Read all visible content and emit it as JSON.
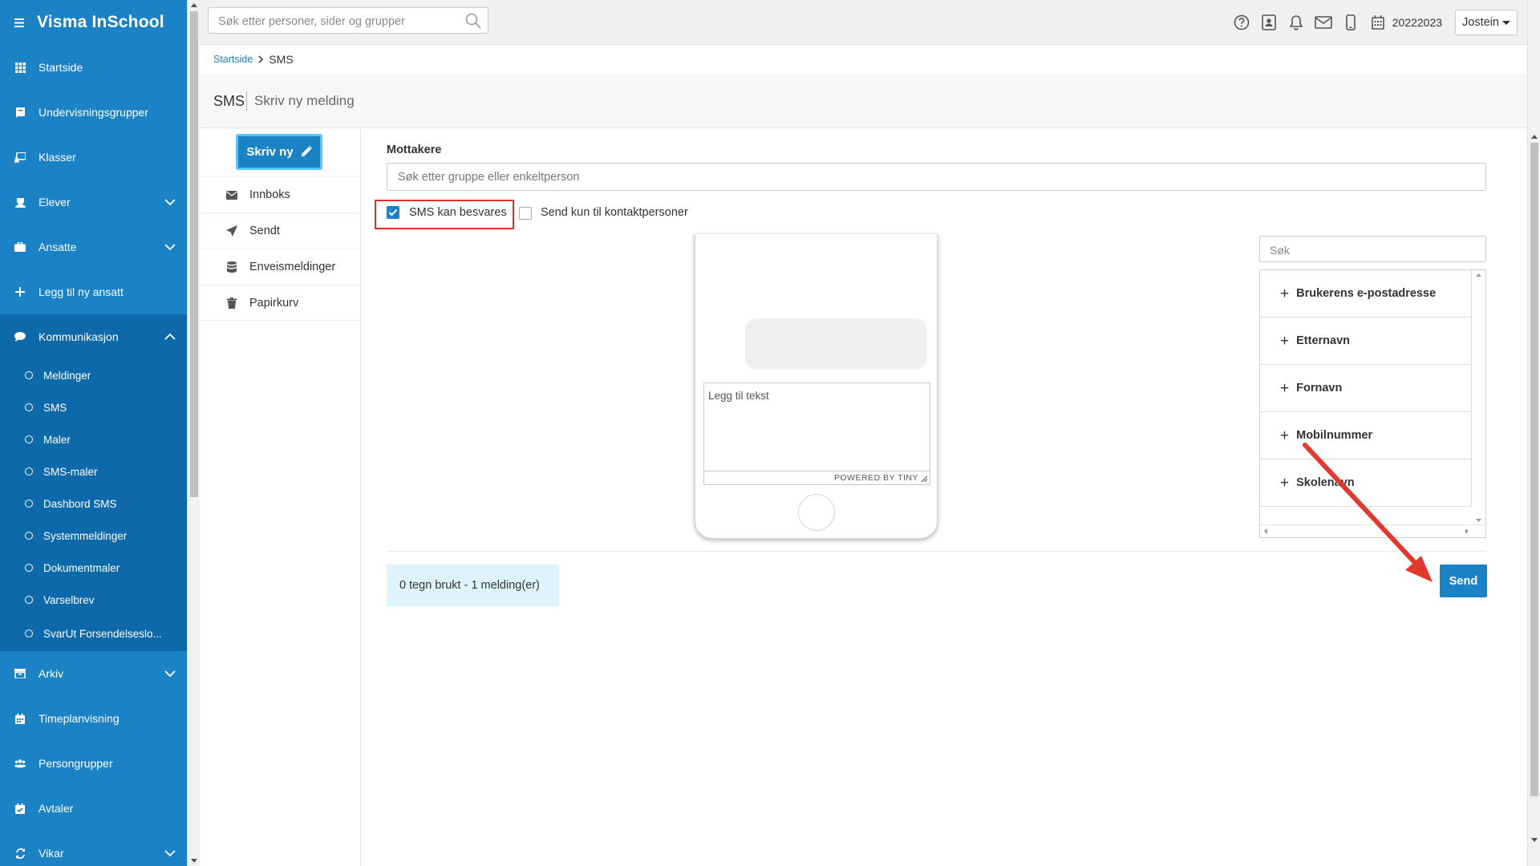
{
  "app": {
    "title": "Visma InSchool"
  },
  "sidebar": {
    "items": [
      {
        "label": "Startside",
        "icon": "grid-icon"
      },
      {
        "label": "Undervisningsgrupper",
        "icon": "book-icon"
      },
      {
        "label": "Klasser",
        "icon": "chalkboard-icon"
      },
      {
        "label": "Elever",
        "icon": "student-icon"
      },
      {
        "label": "Ansatte",
        "icon": "briefcase-icon"
      },
      {
        "label": "Legg til ny ansatt",
        "icon": "plus-icon"
      },
      {
        "label": "Kommunikasjon",
        "icon": "chat-icon"
      },
      {
        "label": "Arkiv",
        "icon": "archive-icon"
      },
      {
        "label": "Timeplanvisning",
        "icon": "calendar-icon"
      },
      {
        "label": "Persongrupper",
        "icon": "users-icon"
      },
      {
        "label": "Avtaler",
        "icon": "calendar-check-icon"
      },
      {
        "label": "Vikar",
        "icon": "swap-icon"
      }
    ],
    "sub_items": [
      "Meldinger",
      "SMS",
      "Maler",
      "SMS-maler",
      "Dashbord SMS",
      "Systemmeldinger",
      "Dokumentmaler",
      "Varselbrev",
      "SvarUt Forsendelseslo..."
    ]
  },
  "topbar": {
    "search_placeholder": "Søk etter personer, sider og grupper",
    "year": "20222023",
    "user": "Jostein"
  },
  "breadcrumb": {
    "home": "Startside",
    "current": "SMS"
  },
  "header": {
    "title": "SMS",
    "subtitle": "Skriv ny melding"
  },
  "subnav": {
    "new_button": "Skriv ny",
    "items": [
      {
        "label": "Innboks",
        "icon": "envelope-icon"
      },
      {
        "label": "Sendt",
        "icon": "paper-plane-icon"
      },
      {
        "label": "Enveismeldinger",
        "icon": "database-icon"
      },
      {
        "label": "Papirkurv",
        "icon": "trash-icon"
      }
    ]
  },
  "form": {
    "recipients_label": "Mottakere",
    "recipients_placeholder": "Søk etter gruppe eller enkeltperson",
    "checkbox_reply": {
      "label": "SMS kan besvares",
      "checked": true
    },
    "checkbox_contacts": {
      "label": "Send kun til kontaktpersoner",
      "checked": false
    },
    "editor_placeholder": "Legg til tekst",
    "editor_brand": "POWERED BY TINY"
  },
  "placeholders": {
    "search_placeholder": "Søk",
    "items": [
      "Brukerens e-postadresse",
      "Etternavn",
      "Fornavn",
      "Mobilnummer",
      "Skolenavn"
    ]
  },
  "footer": {
    "counter": "0 tegn brukt - 1 melding(er)",
    "send_label": "Send"
  },
  "colors": {
    "brand": "#1b82c5",
    "sidebar_section": "#0e69ab",
    "highlight": "#d9342b",
    "counter_bg": "#dff3fc"
  }
}
